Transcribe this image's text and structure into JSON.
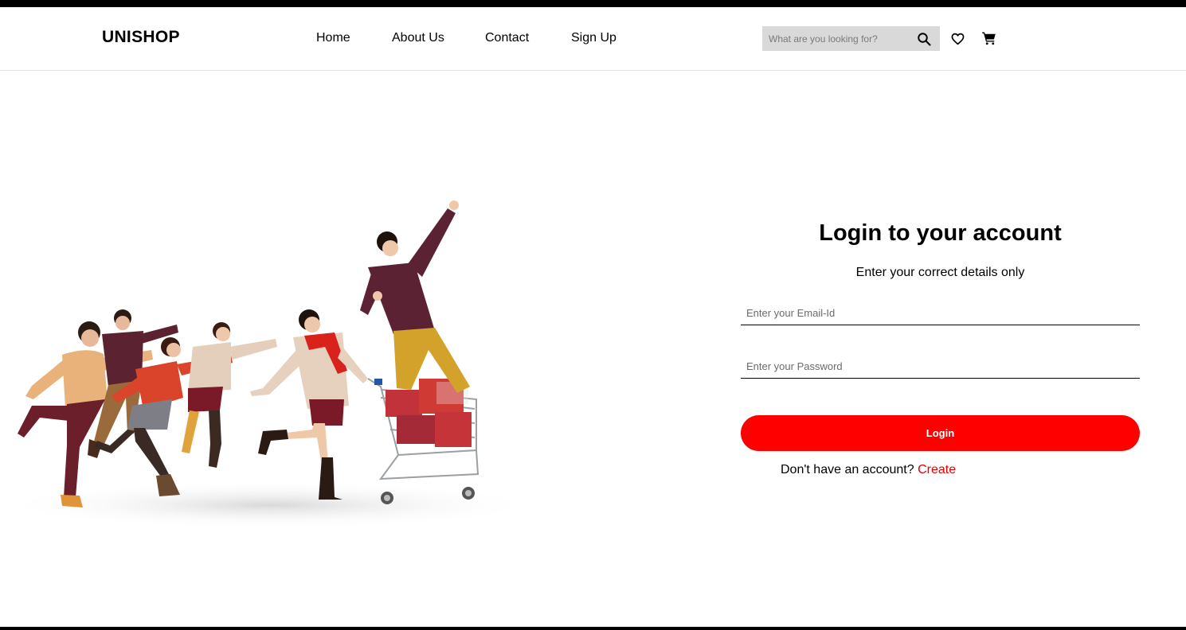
{
  "header": {
    "logo": "UNISHOP",
    "nav": [
      {
        "label": "Home"
      },
      {
        "label": "About Us"
      },
      {
        "label": "Contact"
      },
      {
        "label": "Sign Up"
      }
    ],
    "search": {
      "placeholder": "What are you looking for?",
      "value": ""
    },
    "icons": {
      "search": "search-icon",
      "wishlist": "heart-icon",
      "cart": "cart-icon"
    }
  },
  "login": {
    "title": "Login to your account",
    "subtitle": "Enter your correct details only",
    "email_placeholder": "Enter your Email-Id",
    "email_value": "",
    "password_placeholder": "Enter your Password",
    "password_value": "",
    "button_label": "Login",
    "signup_prompt": "Don't have an account?",
    "signup_link": "Create"
  },
  "colors": {
    "accent": "#ff0000",
    "link": "#e00000",
    "search_bg": "#d9d9d9"
  }
}
